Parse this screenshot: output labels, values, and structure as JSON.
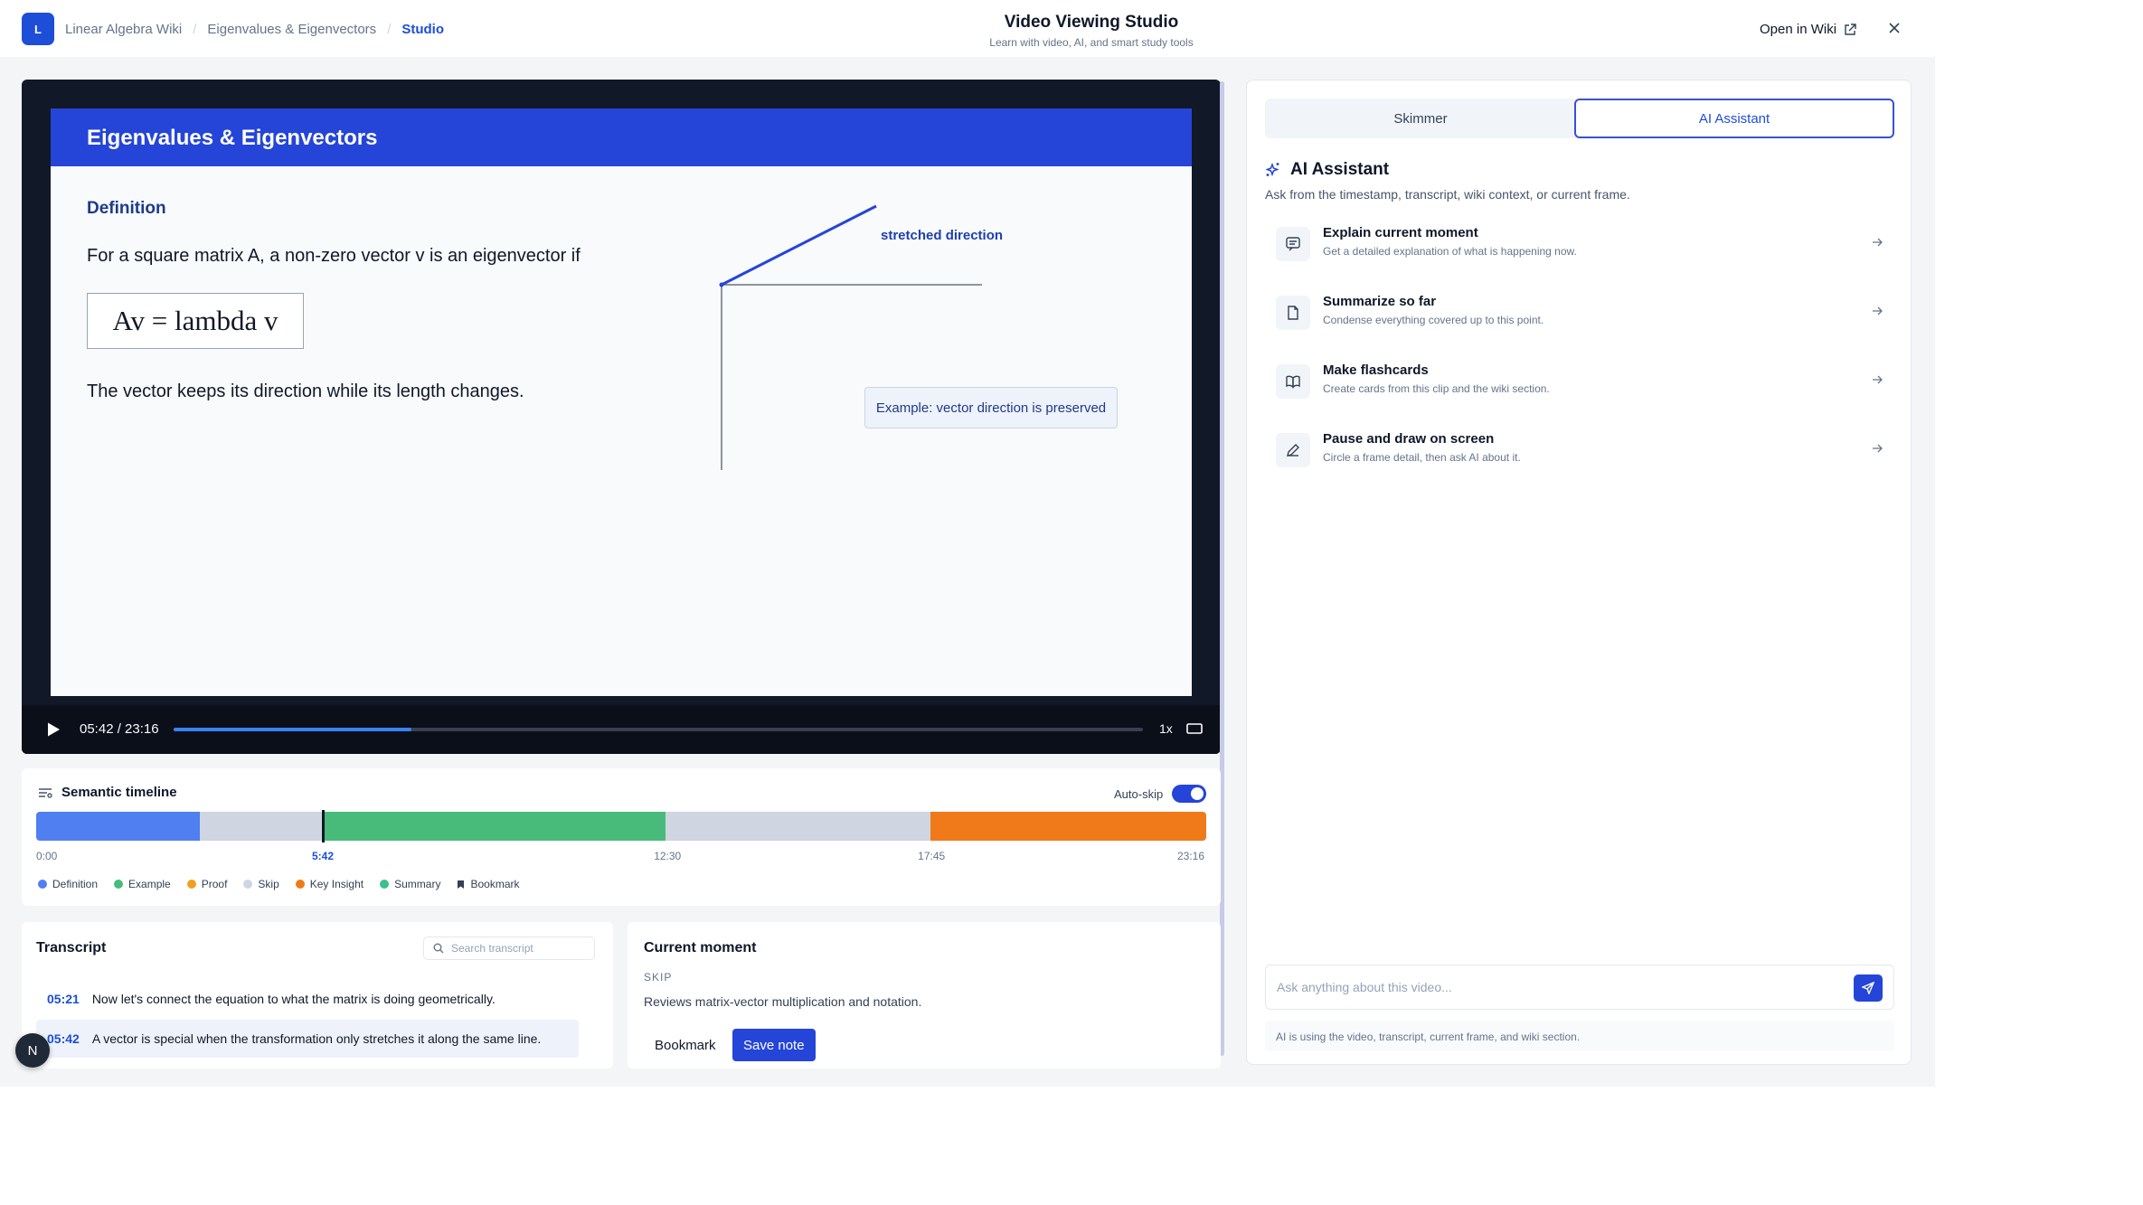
{
  "header": {
    "logo_letter": "L",
    "breadcrumbs": [
      "Linear Algebra Wiki",
      "Eigenvalues & Eigenvectors",
      "Studio"
    ],
    "title": "Video Viewing Studio",
    "subtitle": "Learn with video, AI, and smart study tools",
    "open_wiki": "Open in Wiki"
  },
  "video": {
    "slide": {
      "heading": "Eigenvalues & Eigenvectors",
      "section": "Definition",
      "line1": "For a square matrix A, a non-zero vector v is an eigenvector if",
      "equation": "Av = lambda v",
      "line2": "The vector keeps its direction while its length changes.",
      "stretch_label": "stretched direction",
      "example": "Example: vector direction is preserved"
    },
    "time": "05:42 / 23:16",
    "progress": 0.245,
    "speed": "1x"
  },
  "timeline": {
    "title": "Semantic timeline",
    "autoskip_label": "Auto-skip",
    "autoskip_on": true,
    "total_seconds": 1396,
    "current_seconds": 342,
    "segments": [
      {
        "type": "Definition",
        "start": 0,
        "end": 195,
        "color": "#4f7ff0"
      },
      {
        "type": "Skip",
        "start": 195,
        "end": 342,
        "color": "#cfd5e1"
      },
      {
        "type": "Summary",
        "start": 342,
        "end": 751,
        "color": "#48bb7a"
      },
      {
        "type": "Skip",
        "start": 751,
        "end": 1067,
        "color": "#cfd5e1"
      },
      {
        "type": "Key Insight",
        "start": 1067,
        "end": 1396,
        "color": "#f07a1a"
      }
    ],
    "ticks": [
      "0:00",
      "5:42",
      "12:30",
      "17:45",
      "23:16"
    ],
    "legend": [
      {
        "label": "Definition",
        "color": "#4f7ff0"
      },
      {
        "label": "Example",
        "color": "#48bb7a"
      },
      {
        "label": "Proof",
        "color": "#f0a020"
      },
      {
        "label": "Skip",
        "color": "#cfd5e1"
      },
      {
        "label": "Key Insight",
        "color": "#f07a1a"
      },
      {
        "label": "Summary",
        "color": "#3cc08c"
      },
      {
        "label": "Bookmark",
        "color": "#334155"
      }
    ]
  },
  "transcript": {
    "title": "Transcript",
    "search_placeholder": "Search transcript",
    "rows": [
      {
        "ts": "05:21",
        "text": "Now let's connect the equation to what the matrix is doing geometrically."
      },
      {
        "ts": "05:42",
        "text": "A vector is special when the transformation only stretches it along the same line."
      }
    ]
  },
  "moment": {
    "title": "Current moment",
    "tag": "SKIP",
    "desc": "Reviews matrix-vector multiplication and notation.",
    "bookmark": "Bookmark",
    "save": "Save note"
  },
  "panel": {
    "tabs": [
      "Skimmer",
      "AI Assistant"
    ],
    "active_tab": "AI Assistant",
    "title": "AI Assistant",
    "subtitle": "Ask from the timestamp, transcript, wiki context, or current frame.",
    "actions": [
      {
        "title": "Explain current moment",
        "desc": "Get a detailed explanation of what is happening now.",
        "icon": "chat-icon"
      },
      {
        "title": "Summarize so far",
        "desc": "Condense everything covered up to this point.",
        "icon": "document-icon"
      },
      {
        "title": "Make flashcards",
        "desc": "Create cards from this clip and the wiki section.",
        "icon": "book-icon"
      },
      {
        "title": "Pause and draw on screen",
        "desc": "Circle a frame detail, then ask AI about it.",
        "icon": "pencil-icon"
      }
    ],
    "ask_placeholder": "Ask anything about this video...",
    "note": "AI is using the video, transcript, current frame, and wiki section."
  },
  "fab_letter": "N",
  "colors": {
    "accent": "#2545d8",
    "dark": "#111827"
  }
}
